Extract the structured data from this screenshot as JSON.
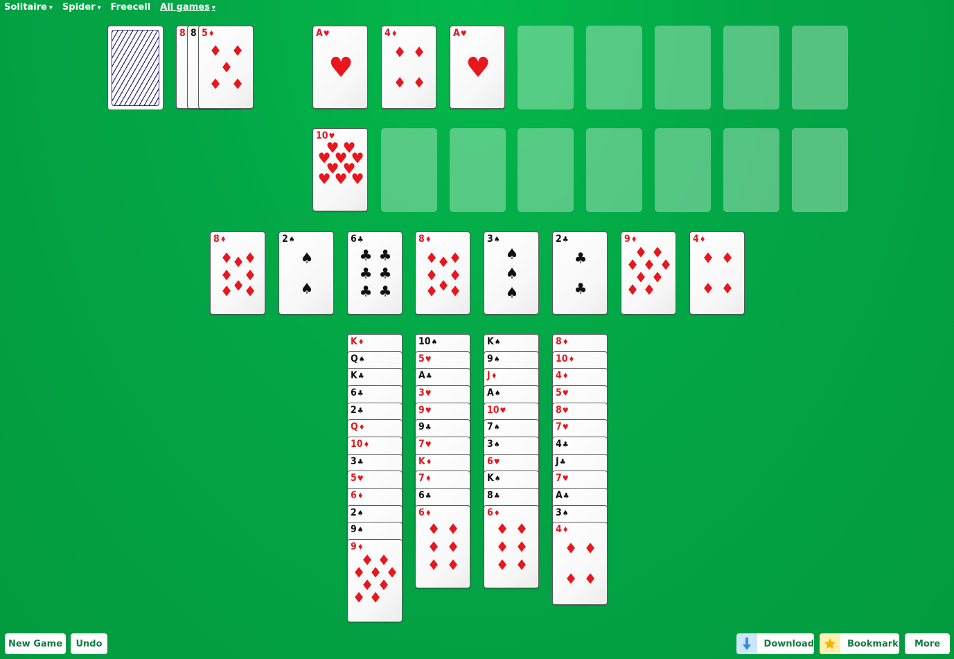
{
  "nav": [
    {
      "label": "Solitaire",
      "caret": "▾"
    },
    {
      "label": "Spider",
      "caret": "▾"
    },
    {
      "label": "Freecell",
      "caret": ""
    },
    {
      "label": "All games",
      "caret": "▾"
    }
  ],
  "buttons": {
    "new_game": "New Game",
    "undo": "Undo",
    "download": "Download",
    "bookmark": "Bookmark",
    "more": "More"
  },
  "waste": [
    {
      "rank": "8",
      "suit": "♥"
    },
    {
      "rank": "8",
      "suit": "♠"
    },
    {
      "rank": "5",
      "suit": "♦"
    }
  ],
  "foundation_row1": [
    {
      "rank": "A",
      "suit": "♥"
    },
    {
      "rank": "4",
      "suit": "♦"
    },
    {
      "rank": "A",
      "suit": "♥"
    },
    null,
    null,
    null,
    null,
    null
  ],
  "foundation_row2": [
    {
      "rank": "10",
      "suit": "♥"
    },
    null,
    null,
    null,
    null,
    null,
    null,
    null
  ],
  "row_cards": [
    {
      "rank": "8",
      "suit": "♦"
    },
    {
      "rank": "2",
      "suit": "♠"
    },
    {
      "rank": "6",
      "suit": "♣"
    },
    {
      "rank": "8",
      "suit": "♦"
    },
    {
      "rank": "3",
      "suit": "♠"
    },
    {
      "rank": "2",
      "suit": "♣"
    },
    {
      "rank": "9",
      "suit": "♦"
    },
    {
      "rank": "4",
      "suit": "♦"
    }
  ],
  "tableau": [
    [
      {
        "rank": "K",
        "suit": "♦"
      },
      {
        "rank": "Q",
        "suit": "♠"
      },
      {
        "rank": "K",
        "suit": "♣"
      },
      {
        "rank": "6",
        "suit": "♣"
      },
      {
        "rank": "2",
        "suit": "♣"
      },
      {
        "rank": "Q",
        "suit": "♦"
      },
      {
        "rank": "10",
        "suit": "♦"
      },
      {
        "rank": "3",
        "suit": "♣"
      },
      {
        "rank": "5",
        "suit": "♥"
      },
      {
        "rank": "6",
        "suit": "♦"
      },
      {
        "rank": "2",
        "suit": "♠"
      },
      {
        "rank": "9",
        "suit": "♠"
      },
      {
        "rank": "9",
        "suit": "♦"
      }
    ],
    [
      {
        "rank": "10",
        "suit": "♠"
      },
      {
        "rank": "5",
        "suit": "♥"
      },
      {
        "rank": "A",
        "suit": "♣"
      },
      {
        "rank": "3",
        "suit": "♥"
      },
      {
        "rank": "9",
        "suit": "♥"
      },
      {
        "rank": "9",
        "suit": "♣"
      },
      {
        "rank": "7",
        "suit": "♥"
      },
      {
        "rank": "K",
        "suit": "♦"
      },
      {
        "rank": "7",
        "suit": "♦"
      },
      {
        "rank": "6",
        "suit": "♣"
      },
      {
        "rank": "6",
        "suit": "♦"
      }
    ],
    [
      {
        "rank": "K",
        "suit": "♠"
      },
      {
        "rank": "9",
        "suit": "♠"
      },
      {
        "rank": "J",
        "suit": "♦"
      },
      {
        "rank": "A",
        "suit": "♠"
      },
      {
        "rank": "10",
        "suit": "♥"
      },
      {
        "rank": "7",
        "suit": "♠"
      },
      {
        "rank": "3",
        "suit": "♠"
      },
      {
        "rank": "6",
        "suit": "♥"
      },
      {
        "rank": "K",
        "suit": "♠"
      },
      {
        "rank": "8",
        "suit": "♣"
      },
      {
        "rank": "6",
        "suit": "♦"
      }
    ],
    [
      {
        "rank": "8",
        "suit": "♦"
      },
      {
        "rank": "10",
        "suit": "♦"
      },
      {
        "rank": "4",
        "suit": "♦"
      },
      {
        "rank": "5",
        "suit": "♥"
      },
      {
        "rank": "8",
        "suit": "♥"
      },
      {
        "rank": "7",
        "suit": "♥"
      },
      {
        "rank": "4",
        "suit": "♣"
      },
      {
        "rank": "J",
        "suit": "♣"
      },
      {
        "rank": "7",
        "suit": "♥"
      },
      {
        "rank": "A",
        "suit": "♣"
      },
      {
        "rank": "3",
        "suit": "♠"
      },
      {
        "rank": "4",
        "suit": "♦"
      }
    ]
  ],
  "colors": {
    "felt": "#03a646",
    "red_suit": "#e8161d",
    "black_suit": "#111111",
    "button_text": "#157a45",
    "card_back": "#23227a"
  },
  "icons": {
    "download": "down-arrow-icon",
    "bookmark": "star-icon"
  }
}
